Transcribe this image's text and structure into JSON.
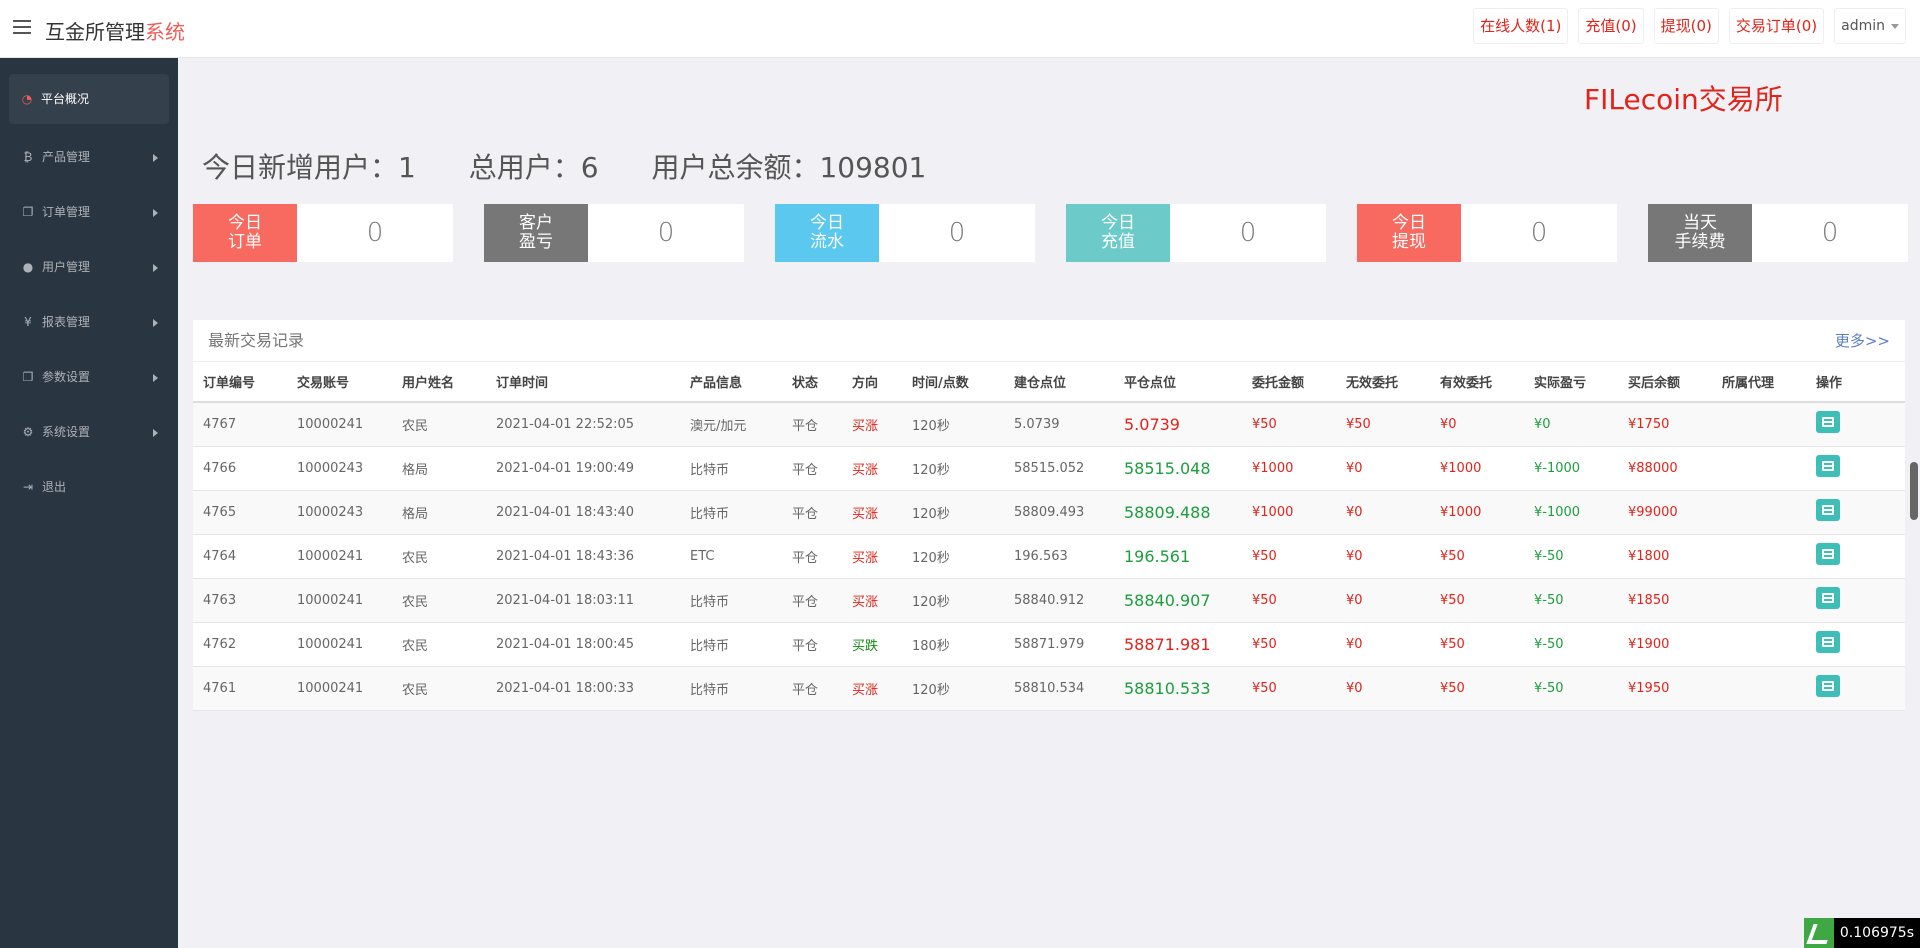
{
  "header": {
    "brand_prefix": "互金所管理",
    "brand_suffix": "系统",
    "links": [
      "在线人数(1)",
      "充值(0)",
      "提现(0)",
      "交易订单(0)"
    ],
    "admin_label": "admin"
  },
  "sidebar": {
    "items": [
      {
        "label": "平台概况",
        "icon": "dashboard-icon"
      },
      {
        "label": "产品管理",
        "icon": "bitcoin-icon"
      },
      {
        "label": "订单管理",
        "icon": "copy-icon"
      },
      {
        "label": "用户管理",
        "icon": "user-icon"
      },
      {
        "label": "报表管理",
        "icon": "yen-icon"
      },
      {
        "label": "参数设置",
        "icon": "copy-icon"
      },
      {
        "label": "系统设置",
        "icon": "gears-icon"
      },
      {
        "label": "退出",
        "icon": "sign-out-icon"
      }
    ]
  },
  "main": {
    "exchange_name": "FILecoin交易所",
    "summary": {
      "new_users": "今日新增用户：1",
      "total_users": "总用户：6",
      "total_balance": "用户总余额：109801"
    },
    "stats": [
      {
        "label_1": "今日",
        "label_2": "订单",
        "value": "0",
        "color": "#f8695f"
      },
      {
        "label_1": "客户",
        "label_2": "盈亏",
        "value": "0",
        "color": "#777777"
      },
      {
        "label_1": "今日",
        "label_2": "流水",
        "value": "0",
        "color": "#5bc8f0"
      },
      {
        "label_1": "今日",
        "label_2": "充值",
        "value": "0",
        "color": "#6ccbc9"
      },
      {
        "label_1": "今日",
        "label_2": "提现",
        "value": "0",
        "color": "#f8695f"
      },
      {
        "label_1": "当天",
        "label_2": "手续费",
        "value": "0",
        "color": "#777777"
      }
    ],
    "panel": {
      "title": "最新交易记录",
      "more": "更多>>",
      "columns": [
        "订单编号",
        "交易账号",
        "用户姓名",
        "订单时间",
        "产品信息",
        "状态",
        "方向",
        "时间/点数",
        "建仓点位",
        "平仓点位",
        "委托金额",
        "无效委托",
        "有效委托",
        "实际盈亏",
        "买后余额",
        "所属代理",
        "操作"
      ],
      "rows": [
        {
          "id": "4767",
          "account": "10000241",
          "name": "农民",
          "time": "2021-04-01 22:52:05",
          "product": "澳元/加元",
          "status": "平仓",
          "direction": "买涨",
          "duration": "120秒",
          "open": "5.0739",
          "close": "5.0739",
          "close_color": "red",
          "amount": "¥50",
          "invalid": "¥50",
          "valid": "¥0",
          "pnl": "¥0",
          "balance": "¥1750",
          "agent": ""
        },
        {
          "id": "4766",
          "account": "10000243",
          "name": "格局",
          "time": "2021-04-01 19:00:49",
          "product": "比特币",
          "status": "平仓",
          "direction": "买涨",
          "duration": "120秒",
          "open": "58515.052",
          "close": "58515.048",
          "close_color": "green",
          "amount": "¥1000",
          "invalid": "¥0",
          "valid": "¥1000",
          "pnl": "¥-1000",
          "balance": "¥88000",
          "agent": ""
        },
        {
          "id": "4765",
          "account": "10000243",
          "name": "格局",
          "time": "2021-04-01 18:43:40",
          "product": "比特币",
          "status": "平仓",
          "direction": "买涨",
          "duration": "120秒",
          "open": "58809.493",
          "close": "58809.488",
          "close_color": "green",
          "amount": "¥1000",
          "invalid": "¥0",
          "valid": "¥1000",
          "pnl": "¥-1000",
          "balance": "¥99000",
          "agent": ""
        },
        {
          "id": "4764",
          "account": "10000241",
          "name": "农民",
          "time": "2021-04-01 18:43:36",
          "product": "ETC",
          "status": "平仓",
          "direction": "买涨",
          "duration": "120秒",
          "open": "196.563",
          "close": "196.561",
          "close_color": "green",
          "amount": "¥50",
          "invalid": "¥0",
          "valid": "¥50",
          "pnl": "¥-50",
          "balance": "¥1800",
          "agent": ""
        },
        {
          "id": "4763",
          "account": "10000241",
          "name": "农民",
          "time": "2021-04-01 18:03:11",
          "product": "比特币",
          "status": "平仓",
          "direction": "买涨",
          "duration": "120秒",
          "open": "58840.912",
          "close": "58840.907",
          "close_color": "green",
          "amount": "¥50",
          "invalid": "¥0",
          "valid": "¥50",
          "pnl": "¥-50",
          "balance": "¥1850",
          "agent": ""
        },
        {
          "id": "4762",
          "account": "10000241",
          "name": "农民",
          "time": "2021-04-01 18:00:45",
          "product": "比特币",
          "status": "平仓",
          "direction": "买跌",
          "duration": "180秒",
          "open": "58871.979",
          "close": "58871.981",
          "close_color": "red",
          "amount": "¥50",
          "invalid": "¥0",
          "valid": "¥50",
          "pnl": "¥-50",
          "balance": "¥1900",
          "agent": ""
        },
        {
          "id": "4761",
          "account": "10000241",
          "name": "农民",
          "time": "2021-04-01 18:00:33",
          "product": "比特币",
          "status": "平仓",
          "direction": "买涨",
          "duration": "120秒",
          "open": "58810.534",
          "close": "58810.533",
          "close_color": "green",
          "amount": "¥50",
          "invalid": "¥0",
          "valid": "¥50",
          "pnl": "¥-50",
          "balance": "¥1950",
          "agent": ""
        }
      ]
    }
  },
  "debug_timer": "0.106975s"
}
